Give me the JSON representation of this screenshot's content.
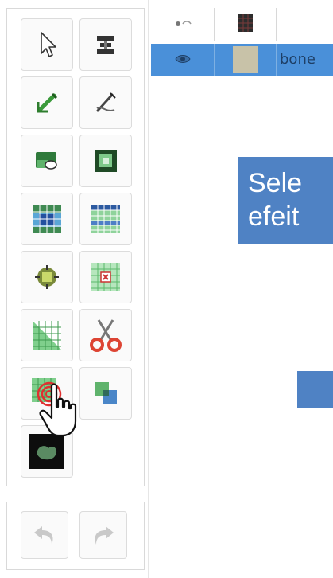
{
  "layers": {
    "header": {
      "visibility_icon": "eye-closed-icon",
      "color_icon": "color-swatch-icon"
    },
    "rows": [
      {
        "name": "bone",
        "visible": true,
        "color": "#c8c2a8",
        "selected": true
      }
    ]
  },
  "callout": {
    "line1": "Sele",
    "line2": "efeit"
  },
  "colors": {
    "selection": "#4a90d9",
    "callout": "#4f82c4",
    "panel_border": "#d9d9d9"
  },
  "tools": [
    {
      "icon": "select-arrow-icon"
    },
    {
      "icon": "slice-filter-icon"
    },
    {
      "icon": "paint-brush-icon"
    },
    {
      "icon": "eraser-pen-icon"
    },
    {
      "icon": "fill-bucket-icon"
    },
    {
      "icon": "region-grow-icon"
    },
    {
      "icon": "grid-select-icon"
    },
    {
      "icon": "grid-table-icon"
    },
    {
      "icon": "dilate-icon"
    },
    {
      "icon": "erode-icon"
    },
    {
      "icon": "grid-staircase-icon"
    },
    {
      "icon": "scissors-icon"
    },
    {
      "icon": "grid-target-icon"
    },
    {
      "icon": "layers-copy-icon"
    },
    {
      "icon": "smooth-blob-icon"
    }
  ],
  "history": [
    {
      "icon": "undo-icon",
      "enabled": false
    },
    {
      "icon": "redo-icon",
      "enabled": false
    }
  ]
}
